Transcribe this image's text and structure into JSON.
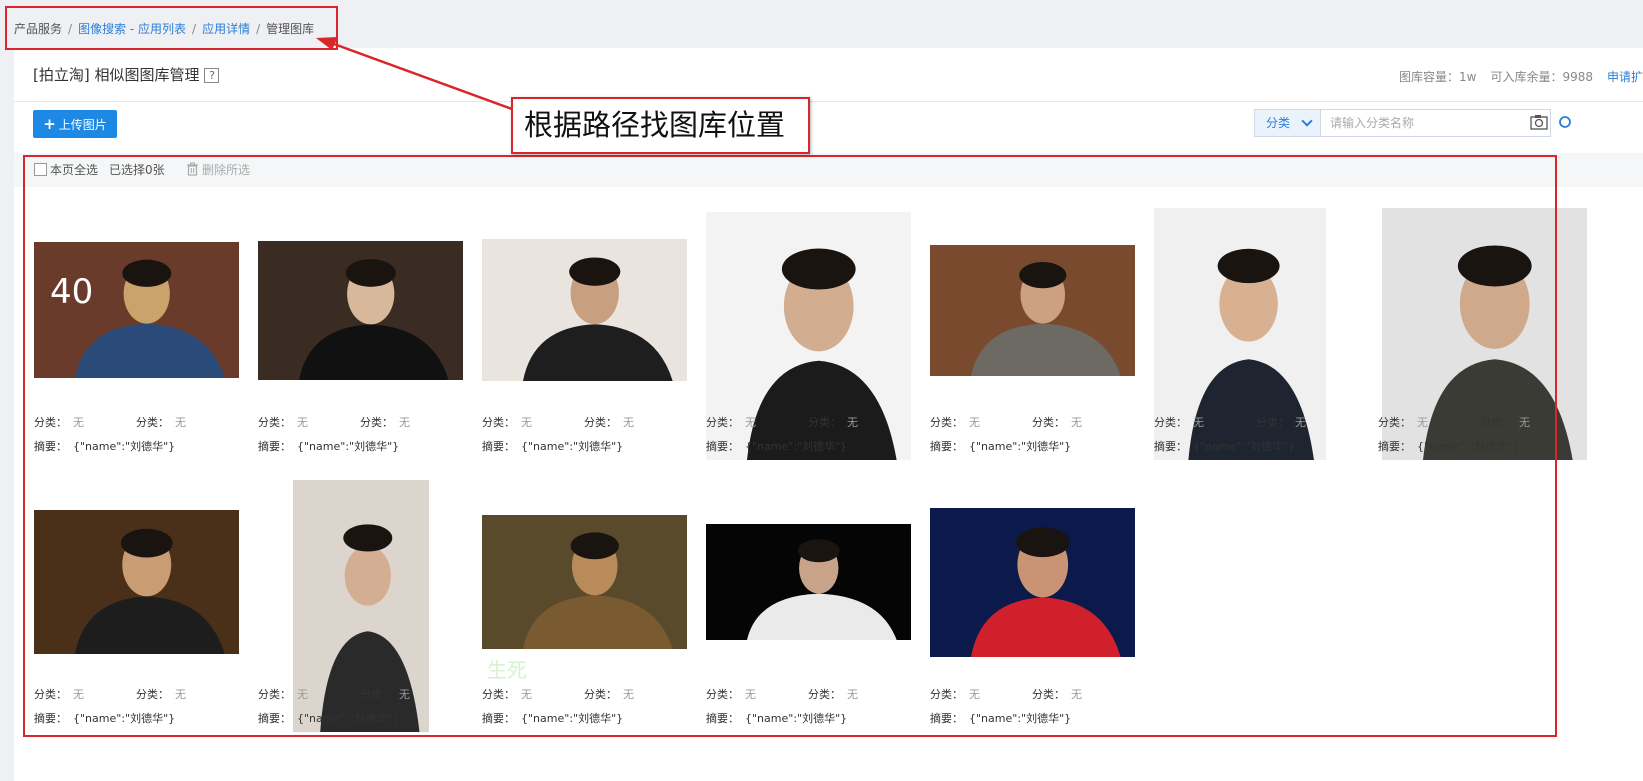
{
  "breadcrumb": {
    "items": [
      "产品服务",
      "图像搜索 - 应用列表",
      "应用详情",
      "管理图库"
    ],
    "sep": "/"
  },
  "header": {
    "title": "[拍立淘] 相似图图库管理",
    "help": "?",
    "capacity_label": "图库容量：1w",
    "remaining_label": "可入库余量：9988",
    "apply_label": "申请扩"
  },
  "toolbar": {
    "upload_label": "上传图片",
    "category_label": "分类",
    "search_placeholder": "请输入分类名称",
    "select_all_label": "本页全选",
    "selected_label": "已选择0张",
    "delete_label": "删除所选"
  },
  "annotation": {
    "callout_text": "根据路径找图库位置"
  },
  "colors": {
    "accent": "#1e88e5",
    "link": "#2b7fd8",
    "annotation_red": "#d9262b"
  },
  "cards": [
    {
      "cat1_label": "分类：",
      "cat1_value": "无",
      "cat2_label": "分类：",
      "cat2_value": "无",
      "summary_label": "摘要：",
      "summary_value": "{\"name\":\"刘德华\"}",
      "overlay_text": "40"
    },
    {
      "cat1_label": "分类：",
      "cat1_value": "无",
      "cat2_label": "分类：",
      "cat2_value": "无",
      "summary_label": "摘要：",
      "summary_value": "{\"name\":\"刘德华\"}"
    },
    {
      "cat1_label": "分类：",
      "cat1_value": "无",
      "cat2_label": "分类：",
      "cat2_value": "无",
      "summary_label": "摘要：",
      "summary_value": "{\"name\":\"刘德华\"}"
    },
    {
      "cat1_label": "分类：",
      "cat1_value": "无",
      "cat2_label": "分类：",
      "cat2_value": "无",
      "summary_label": "摘要：",
      "summary_value": "{\"name\":\"刘德华\"}"
    },
    {
      "cat1_label": "分类：",
      "cat1_value": "无",
      "cat2_label": "分类：",
      "cat2_value": "无",
      "summary_label": "摘要：",
      "summary_value": "{\"name\":\"刘德华\"}"
    },
    {
      "cat1_label": "分类：",
      "cat1_value": "无",
      "cat2_label": "分类：",
      "cat2_value": "无",
      "summary_label": "摘要：",
      "summary_value": "{\"name\":\"刘德华\"}"
    },
    {
      "cat1_label": "分类：",
      "cat1_value": "无",
      "cat2_label": "分类：",
      "cat2_value": "无",
      "summary_label": "摘要：",
      "summary_value": "{\"name\":\"刘德华\"}"
    },
    {
      "cat1_label": "分类：",
      "cat1_value": "无",
      "cat2_label": "分类：",
      "cat2_value": "无",
      "summary_label": "摘要：",
      "summary_value": "{\"name\":\"刘德华\"}"
    },
    {
      "cat1_label": "分类：",
      "cat1_value": "无",
      "cat2_label": "分类：",
      "cat2_value": "无",
      "summary_label": "摘要：",
      "summary_value": "{\"name\":\"刘德华\"}"
    },
    {
      "cat1_label": "分类：",
      "cat1_value": "无",
      "cat2_label": "分类：",
      "cat2_value": "无",
      "summary_label": "摘要：",
      "summary_value": "{\"name\":\"刘德华\"}",
      "overlay_text": "生死"
    },
    {
      "cat1_label": "分类：",
      "cat1_value": "无",
      "cat2_label": "分类：",
      "cat2_value": "无",
      "summary_label": "摘要：",
      "summary_value": "{\"name\":\"刘德华\"}"
    },
    {
      "cat1_label": "分类：",
      "cat1_value": "无",
      "cat2_label": "分类：",
      "cat2_value": "无",
      "summary_label": "摘要：",
      "summary_value": "{\"name\":\"刘德华\"}"
    }
  ]
}
